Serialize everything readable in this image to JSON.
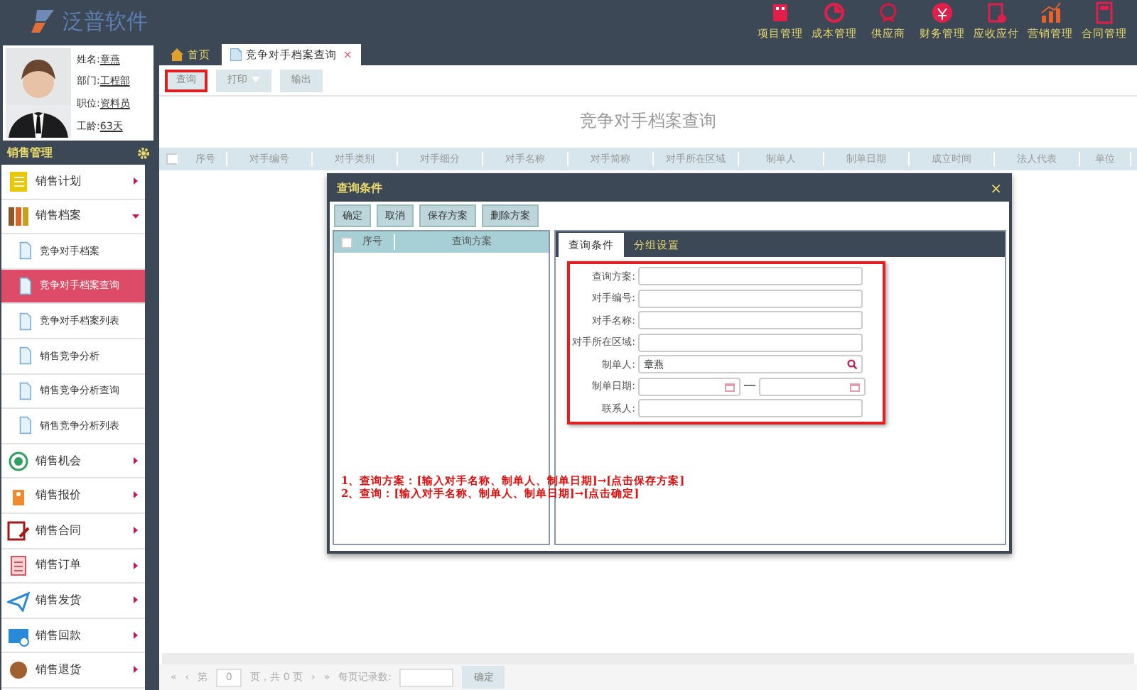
{
  "app": {
    "logo_text": "泛普软件"
  },
  "top_menu": [
    {
      "label": "项目管理"
    },
    {
      "label": "成本管理"
    },
    {
      "label": "供应商"
    },
    {
      "label": "财务管理"
    },
    {
      "label": "应收应付"
    },
    {
      "label": "营销管理"
    },
    {
      "label": "合同管理"
    }
  ],
  "profile": {
    "fields": [
      {
        "label": "姓名:",
        "value": "章燕"
      },
      {
        "label": "部门:",
        "value": "工程部"
      },
      {
        "label": "职位:",
        "value": "资料员"
      },
      {
        "label": "工龄:",
        "value": "63天"
      }
    ]
  },
  "sidebar": {
    "title": "销售管理",
    "items": [
      {
        "label": "销售计划",
        "expanded": false,
        "selected": false
      },
      {
        "label": "销售档案",
        "expanded": true,
        "selected": false,
        "children": [
          {
            "label": "竞争对手档案",
            "selected": false
          },
          {
            "label": "竞争对手档案查询",
            "selected": true
          },
          {
            "label": "竞争对手档案列表",
            "selected": false
          },
          {
            "label": "销售竞争分析",
            "selected": false
          },
          {
            "label": "销售竞争分析查询",
            "selected": false
          },
          {
            "label": "销售竞争分析列表",
            "selected": false
          }
        ]
      },
      {
        "label": "销售机会",
        "expanded": false,
        "selected": false
      },
      {
        "label": "销售报价",
        "expanded": false,
        "selected": false
      },
      {
        "label": "销售合同",
        "expanded": false,
        "selected": false
      },
      {
        "label": "销售订单",
        "expanded": false,
        "selected": false
      },
      {
        "label": "销售发货",
        "expanded": false,
        "selected": false
      },
      {
        "label": "销售回款",
        "expanded": false,
        "selected": false
      },
      {
        "label": "销售退货",
        "expanded": false,
        "selected": false
      }
    ]
  },
  "tabs": [
    {
      "label": "首页",
      "kind": "home",
      "selected": false
    },
    {
      "label": "竞争对手档案查询",
      "kind": "page",
      "selected": true,
      "close": "×"
    }
  ],
  "toolbar": [
    {
      "label": "查询",
      "highlighted": true,
      "dropdown": false
    },
    {
      "label": "打印",
      "highlighted": false,
      "dropdown": true
    },
    {
      "label": "输出",
      "highlighted": false,
      "dropdown": false
    }
  ],
  "page_title": "竞争对手档案查询",
  "table": {
    "select_all_checked": false,
    "columns": [
      "序号",
      "对手编号",
      "对手类别",
      "对手细分",
      "对手名称",
      "对手简称",
      "对手所在区域",
      "制单人",
      "制单日期",
      "成立时间",
      "法人代表",
      "单位"
    ]
  },
  "pager": {
    "first": "«",
    "prev": "‹",
    "page_prefix": "第",
    "page": "0",
    "page_suffix": "页，共 0 页",
    "next": "›",
    "last": "»",
    "per_page_label": "每页记录数:",
    "confirm": "确定"
  },
  "dialog": {
    "title": "查询条件",
    "close": "×",
    "buttons": [
      "确定",
      "取消",
      "保存方案",
      "删除方案"
    ],
    "list_select_all_checked": false,
    "list_columns": [
      "序号",
      "查询方案"
    ],
    "tabs": [
      {
        "label": "查询条件",
        "selected": true
      },
      {
        "label": "分组设置",
        "selected": false
      }
    ],
    "fields": [
      {
        "label": "查询方案:",
        "kind": "text"
      },
      {
        "label": "对手编号:",
        "kind": "text"
      },
      {
        "label": "对手名称:",
        "kind": "text"
      },
      {
        "label": "对手所在区域:",
        "kind": "text"
      },
      {
        "label": "制单人:",
        "kind": "search",
        "value": "章燕"
      },
      {
        "label": "制单日期:",
        "kind": "daterange",
        "separator": "—"
      },
      {
        "label": "联系人:",
        "kind": "text"
      }
    ],
    "notes": [
      "1、查询方案：[输入对手名称、制单人、制单日期]→[点击保存方案]",
      "2、查询：[输入对手名称、制单人、制单日期]→[点击确定]"
    ]
  }
}
